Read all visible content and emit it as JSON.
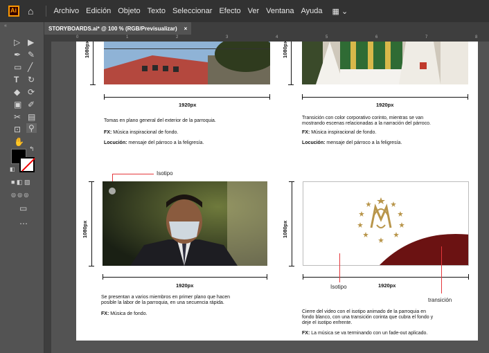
{
  "menubar": {
    "logo_text": "Ai",
    "items": [
      "Archivo",
      "Edición",
      "Objeto",
      "Texto",
      "Seleccionar",
      "Efecto",
      "Ver",
      "Ventana",
      "Ayuda"
    ]
  },
  "document_tab": {
    "title": "STORYBOARDS.ai* @ 100 % (RGB/Previsualizar)",
    "close_glyph": "×"
  },
  "ruler_ticks": [
    "0",
    "1",
    "2",
    "3",
    "4",
    "5",
    "6",
    "7",
    "8"
  ],
  "panels": [
    {
      "width_label": "1920px",
      "height_label": "1080px",
      "caption_line1": "Tomas en plano general del exterior de la parroquia.",
      "fx_label": "FX:",
      "fx_text": " Música inspiracional de fondo.",
      "loc_label": "Locución:",
      "loc_text": " mensaje del párroco a la feligresía."
    },
    {
      "width_label": "1920px",
      "height_label": "1080px",
      "caption_line1": "Transición con color corporativo corinto, mientras se van",
      "caption_line2": "mostrando escenas relacionadas a la narración del párroco.",
      "fx_label": "FX:",
      "fx_text": " Música inspiracional de fondo.",
      "loc_label": "Locución:",
      "loc_text": " mensaje del párroco a la feligresía."
    },
    {
      "width_label": "1920px",
      "height_label": "1080px",
      "annotation": "Isotipo",
      "caption_line1": "Se presentan a varios miembros en primer plano que hacen",
      "caption_line2": "posible la labor de la parroquia, en una secuencia rápida.",
      "fx_label": "FX:",
      "fx_text": " Música de fondo."
    },
    {
      "width_label": "1920px",
      "height_label": "1080px",
      "annotation_isotipo": "Isotipo",
      "annotation_transition": "transición",
      "caption_line1": "Cierre del video con el isotipo animado de la parroquia en",
      "caption_line2": "fondo blanco, con una transición corinta que cubra el fondo y",
      "caption_line3": "deje el isotipo enfrente.",
      "fx_label": "FX:",
      "fx_text": " La música se va terminando con un fade-out aplicado."
    }
  ],
  "colors": {
    "corinto": "#6b1212",
    "gold": "#b8954a",
    "annotation": "#e5363b"
  }
}
